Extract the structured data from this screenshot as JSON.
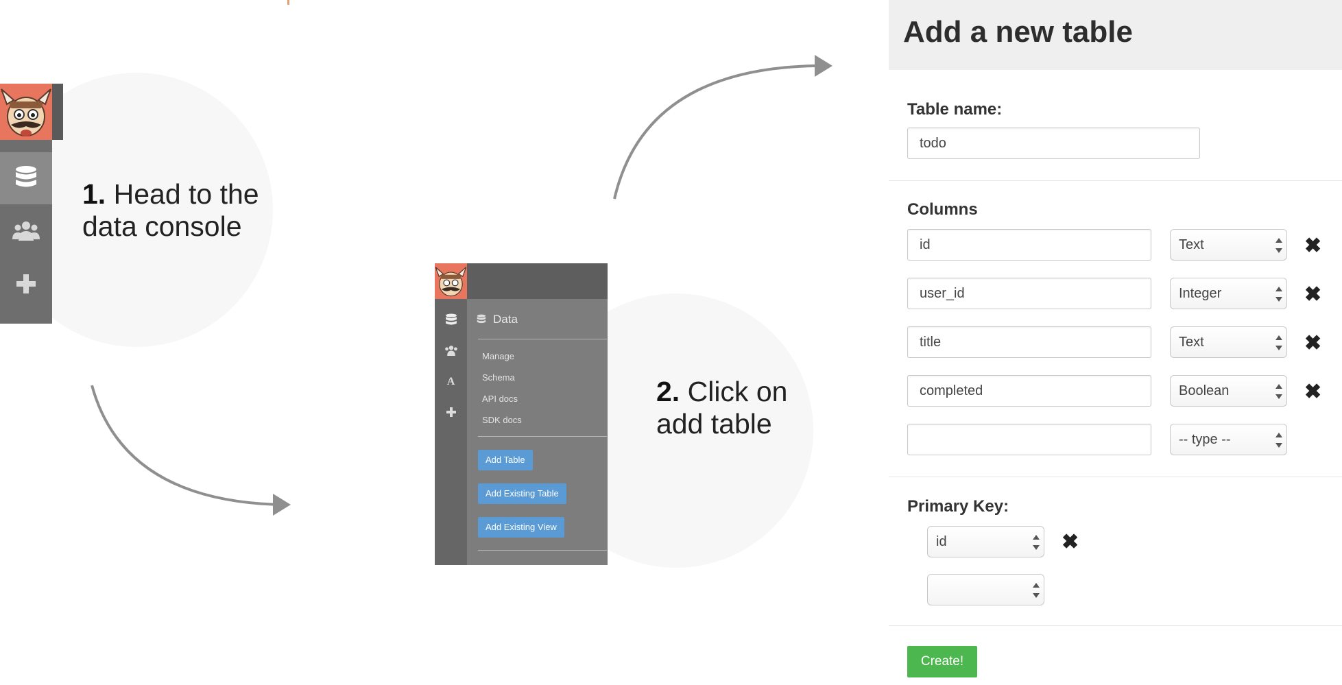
{
  "step1": {
    "num": "1.",
    "line1": "Head to the",
    "line2": "data console",
    "sidebar_icons": [
      "mascot-logo",
      "database-icon",
      "users-icon",
      "plus-icon"
    ]
  },
  "step2": {
    "num": "2.",
    "line1": "Click on",
    "line2": "add table",
    "console": {
      "section_title": "Data",
      "links": [
        "Manage",
        "Schema",
        "API docs",
        "SDK docs"
      ],
      "buttons": [
        "Add Table",
        "Add Existing Table",
        "Add Existing View"
      ]
    }
  },
  "form": {
    "title": "Add a new table",
    "table_name_label": "Table name:",
    "table_name_value": "todo",
    "columns_label": "Columns",
    "columns": [
      {
        "name": "id",
        "type": "Text"
      },
      {
        "name": "user_id",
        "type": "Integer"
      },
      {
        "name": "title",
        "type": "Text"
      },
      {
        "name": "completed",
        "type": "Boolean"
      },
      {
        "name": "",
        "type": "-- type --"
      }
    ],
    "remove_glyph": "✖",
    "primary_key_label": "Primary Key:",
    "primary_keys": [
      "id",
      ""
    ],
    "create_label": "Create!"
  },
  "colors": {
    "brand_orange": "#e8765e",
    "sidebar_gray": "#6e6e6e",
    "button_blue": "#5b9bd5",
    "create_green": "#4cb74f"
  }
}
